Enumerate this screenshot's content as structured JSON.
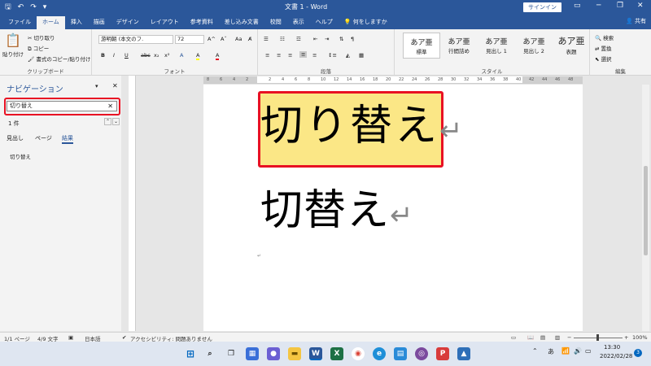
{
  "titlebar": {
    "title": "文書 1 - Word",
    "signin": "サインイン",
    "qat": [
      "🖫",
      "↶",
      "↷",
      "▾"
    ],
    "win_min": "─",
    "win_restore": "❐",
    "win_close": "✕",
    "ribbon_opts": "▭"
  },
  "tabs": [
    "ファイル",
    "ホーム",
    "挿入",
    "描画",
    "デザイン",
    "レイアウト",
    "参考資料",
    "差し込み文書",
    "校閲",
    "表示",
    "ヘルプ",
    "何をしますか"
  ],
  "share": "共有",
  "ribbon": {
    "paste": "貼り付け",
    "cut": "切り取り",
    "copy": "コピー",
    "format_painter": "書式のコピー/貼り付け",
    "clipboard": "クリップボード",
    "font_name": "游明朝 (本文のフ.",
    "font_size": "72",
    "font_group": "フォント",
    "paragraph": "段落",
    "styles": [
      {
        "sample": "あア亜",
        "label": "標準"
      },
      {
        "sample": "あア亜",
        "label": "行間詰め"
      },
      {
        "sample": "あア亜",
        "label": "見出し 1"
      },
      {
        "sample": "あア亜",
        "label": "見出し 2"
      },
      {
        "sample": "あア亜",
        "label": "表題"
      }
    ],
    "style_group": "スタイル",
    "find": "検索",
    "replace": "置換",
    "select": "選択",
    "edit_group": "編集",
    "font_buttons": [
      "B",
      "I",
      "U",
      "abc",
      "x₂",
      "x²",
      "A",
      "A",
      "A"
    ],
    "para_buttons": [
      "≡",
      "≡",
      "≡",
      "≡",
      "≡"
    ]
  },
  "nav": {
    "title": "ナビゲーション",
    "search_value": "切り替え",
    "count": "1 件",
    "tabs": [
      "見出し",
      "ページ",
      "結果"
    ],
    "result": "切り替え"
  },
  "ruler": {
    "left_ticks": [
      "8",
      "6",
      "4",
      "2"
    ],
    "right_ticks": [
      "2",
      "4",
      "6",
      "8",
      "10",
      "12",
      "14",
      "16",
      "18",
      "20",
      "22",
      "24",
      "26",
      "28",
      "30",
      "32",
      "34",
      "36",
      "38",
      "40",
      "42",
      "44",
      "46",
      "48"
    ]
  },
  "document": {
    "line1": "切り替え",
    "line2": "切替え",
    "para_mark": "↵",
    "small_mark": "↵",
    "highlight_color": "#fbe786"
  },
  "status": {
    "page": "1/1 ページ",
    "chars": "4/9 文字",
    "lang": "日本語",
    "access": "アクセシビリティ: 問題ありません",
    "zoom": "100%"
  },
  "taskbar": {
    "time": "13:30",
    "date": "2022/02/28",
    "ime": "あ",
    "notif": "3"
  },
  "colors": {
    "brand": "#2b579a",
    "red_box": "#e81123"
  }
}
